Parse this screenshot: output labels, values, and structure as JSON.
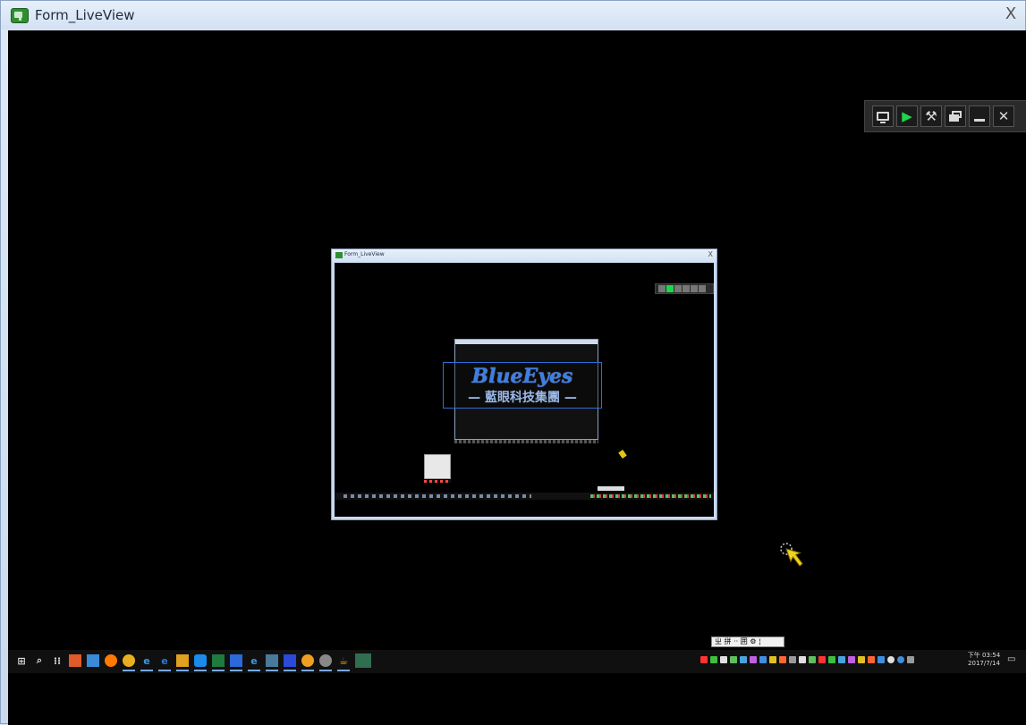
{
  "window": {
    "title": "Form_LiveView",
    "close_glyph": "X"
  },
  "toolbar": {
    "buttons": [
      {
        "name": "monitor-icon",
        "glyph": ""
      },
      {
        "name": "play-icon",
        "glyph": "▶"
      },
      {
        "name": "tools-icon",
        "glyph": "⚒"
      },
      {
        "name": "screens-icon",
        "glyph": ""
      },
      {
        "name": "minimize-icon",
        "glyph": ""
      },
      {
        "name": "close-icon",
        "glyph": "✕"
      }
    ]
  },
  "nested": {
    "title": "Form_LiveView",
    "close_glyph": "X",
    "logo_text": "BlueEyes",
    "logo_subtitle": "— 藍眼科技集團 —"
  },
  "ime": {
    "text": "ㄓ 拼 ·· 囲 ⚙ ¦"
  },
  "taskbar": {
    "clock_time": "下午 03:54",
    "clock_date": "2017/7/14",
    "colors": {
      "tray": [
        "#ff3333",
        "#3fbf3f",
        "#e0e0e0",
        "#5fbf5f",
        "#4aa3df",
        "#c060e0",
        "#3f8fdf",
        "#e0c020",
        "#ff6633",
        "#9a9a9a"
      ]
    }
  },
  "colors": {
    "accent_play": "#19d84a",
    "logo_blue": "#3d7ee6"
  }
}
